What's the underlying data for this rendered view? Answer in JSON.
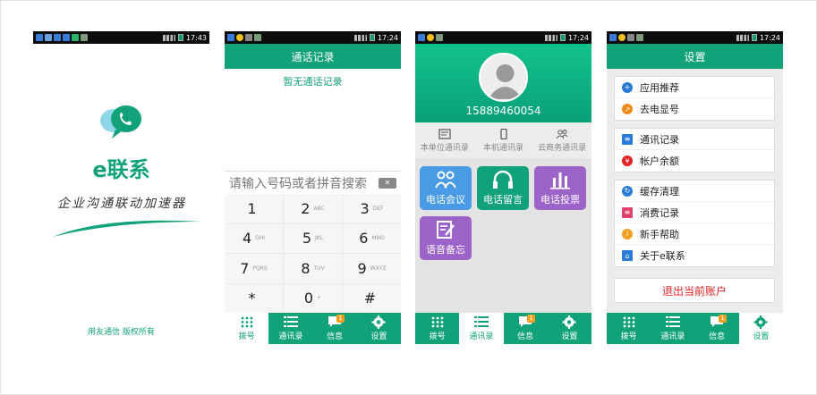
{
  "colors": {
    "primary": "#11a27a",
    "tile_blue": "#4a9be6",
    "tile_green": "#12a27b",
    "tile_purple": "#9c63c9",
    "logout_red": "#e52222"
  },
  "screen1": {
    "status_time": "17:43",
    "brand": "e联系",
    "slogan": "企业沟通联动加速器",
    "copyright": "用友通信 版权所有"
  },
  "screen2": {
    "status_time": "17:24",
    "title": "通话记录",
    "empty_text": "暂无通话记录",
    "input_placeholder": "请输入号码或者拼音搜索",
    "keys": [
      {
        "digit": "1",
        "letters": ""
      },
      {
        "digit": "2",
        "letters": "ABC"
      },
      {
        "digit": "3",
        "letters": "DEF"
      },
      {
        "digit": "4",
        "letters": "GHI"
      },
      {
        "digit": "5",
        "letters": "JKL"
      },
      {
        "digit": "6",
        "letters": "MNO"
      },
      {
        "digit": "7",
        "letters": "PQRS"
      },
      {
        "digit": "8",
        "letters": "TUV"
      },
      {
        "digit": "9",
        "letters": "WXYZ"
      },
      {
        "digit": "*",
        "letters": ""
      },
      {
        "digit": "0",
        "letters": "+"
      },
      {
        "digit": "#",
        "letters": ""
      }
    ],
    "tabs": [
      {
        "label": "拨号",
        "icon": "dialpad-icon",
        "badge": ""
      },
      {
        "label": "通讯录",
        "icon": "list-icon",
        "badge": ""
      },
      {
        "label": "信息",
        "icon": "message-icon",
        "badge": "1"
      },
      {
        "label": "设置",
        "icon": "gear-icon",
        "badge": ""
      }
    ]
  },
  "screen3": {
    "status_time": "17:24",
    "phone_number": "15889460054",
    "segments": [
      {
        "label": "本单位通讯录",
        "icon": "id-card-icon"
      },
      {
        "label": "本机通讯录",
        "icon": "phone-device-icon"
      },
      {
        "label": "云商务通讯录",
        "icon": "people-icon"
      }
    ],
    "tiles": [
      {
        "label": "电话会议",
        "icon": "conference-icon"
      },
      {
        "label": "电话留言",
        "icon": "headset-icon"
      },
      {
        "label": "电话投票",
        "icon": "bar-chart-icon"
      },
      {
        "label": "语音备忘",
        "icon": "memo-icon"
      }
    ],
    "tabs": [
      {
        "label": "拨号",
        "badge": ""
      },
      {
        "label": "通讯录",
        "badge": ""
      },
      {
        "label": "信息",
        "badge": "1"
      },
      {
        "label": "设置",
        "badge": ""
      }
    ]
  },
  "screen4": {
    "status_time": "17:24",
    "title": "设置",
    "group1": [
      {
        "label": "应用推荐",
        "icon": "plus-circle-icon",
        "color": "#2a7ad8"
      },
      {
        "label": "去电显号",
        "icon": "outgoing-call-icon",
        "color": "#f08a1a"
      }
    ],
    "group2": [
      {
        "label": "通讯记录",
        "icon": "record-icon",
        "color": "#2a7ad8"
      },
      {
        "label": "帐户余额",
        "icon": "yen-icon",
        "color": "#e52222"
      }
    ],
    "group3": [
      {
        "label": "缓存清理",
        "icon": "refresh-icon",
        "color": "#2a7ad8"
      },
      {
        "label": "消费记录",
        "icon": "receipt-icon",
        "color": "#e0416a"
      },
      {
        "label": "新手帮助",
        "icon": "info-icon",
        "color": "#f0a020"
      },
      {
        "label": "关于e联系",
        "icon": "home-icon",
        "color": "#2a7ad8"
      }
    ],
    "logout": "退出当前账户",
    "tabs": [
      {
        "label": "拨号",
        "badge": ""
      },
      {
        "label": "通讯录",
        "badge": ""
      },
      {
        "label": "信息",
        "badge": "1"
      },
      {
        "label": "设置",
        "badge": ""
      }
    ]
  }
}
